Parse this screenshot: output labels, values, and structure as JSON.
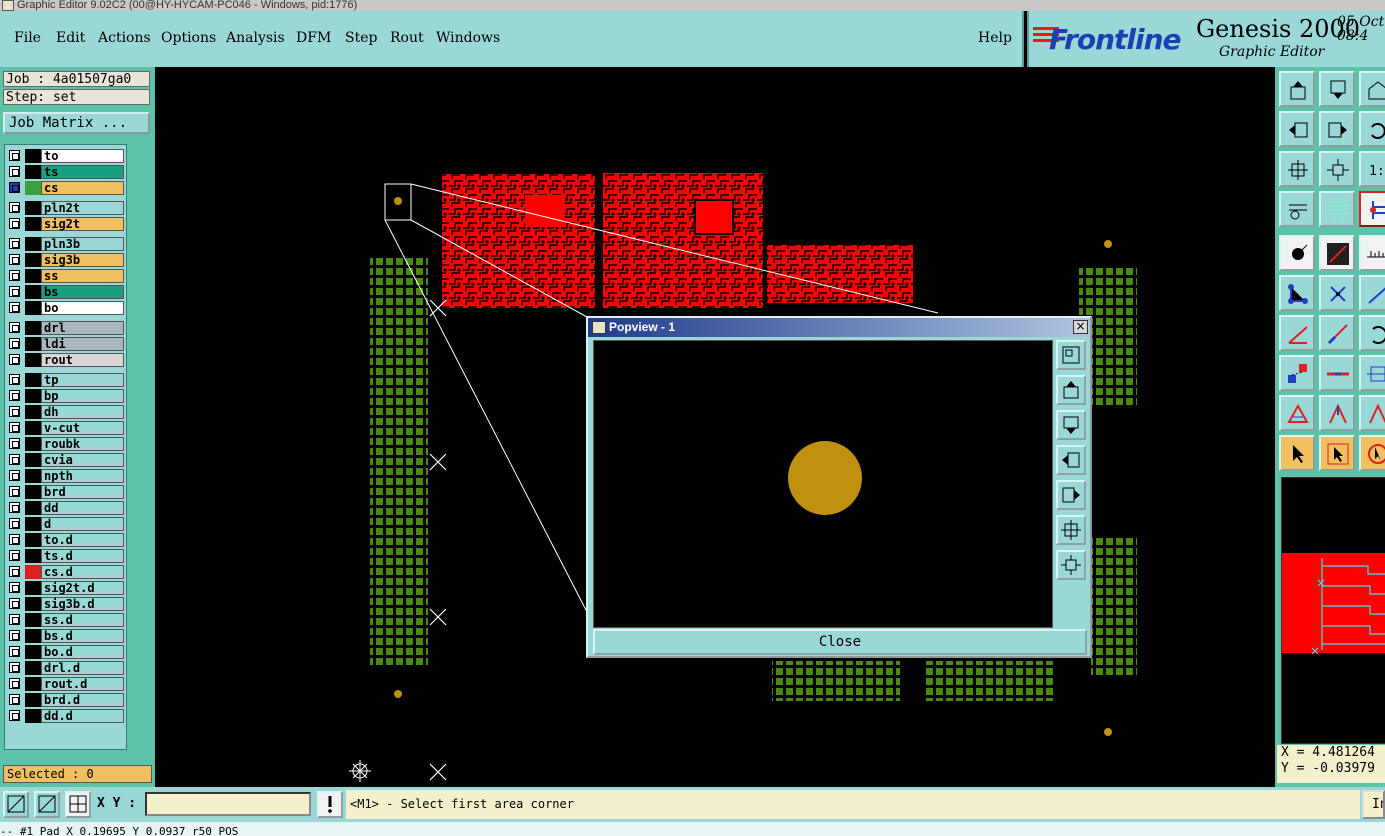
{
  "window_title": "Graphic Editor 9.02C2 (00@HY-HYCAM-PC046 - Windows, pid:1776)",
  "menu": [
    "File",
    "Edit",
    "Actions",
    "Options",
    "Analysis",
    "DFM",
    "Step",
    "Rout",
    "Windows"
  ],
  "help_label": "Help",
  "brand": {
    "logo": "Frontline",
    "product": "Genesis 2000",
    "subtitle": "Graphic Editor",
    "date": "05 Oct",
    "time": "08:4"
  },
  "job": {
    "job_line": "Job : 4a01507ga0",
    "step_line": "Step: set",
    "job_matrix_label": "Job Matrix ..."
  },
  "layers": [
    {
      "name": "to",
      "color": "#ffffff"
    },
    {
      "name": "ts",
      "color": "#1aa080"
    },
    {
      "name": "cs",
      "color": "#f0c060"
    },
    {
      "name": "pln2t",
      "color": "#9ad8d8"
    },
    {
      "name": "sig2t",
      "color": "#f0c060"
    },
    {
      "name": "pln3b",
      "color": "#9ad8d8"
    },
    {
      "name": "sig3b",
      "color": "#f0c060"
    },
    {
      "name": "ss",
      "color": "#f0c060"
    },
    {
      "name": "bs",
      "color": "#1aa080"
    },
    {
      "name": "bo",
      "color": "#ffffff"
    },
    {
      "name": "drl",
      "color": "#a8b8c0"
    },
    {
      "name": "ldi",
      "color": "#a8b8c0"
    },
    {
      "name": "rout",
      "color": "#d8d8d8"
    },
    {
      "name": "tp",
      "color": "#9ad8d8"
    },
    {
      "name": "bp",
      "color": "#9ad8d8"
    },
    {
      "name": "dh",
      "color": "#9ad8d8"
    },
    {
      "name": "v-cut",
      "color": "#9ad8d8"
    },
    {
      "name": "roubk",
      "color": "#9ad8d8"
    },
    {
      "name": "cvia",
      "color": "#9ad8d8"
    },
    {
      "name": "npth",
      "color": "#9ad8d8"
    },
    {
      "name": "brd",
      "color": "#9ad8d8"
    },
    {
      "name": "dd",
      "color": "#9ad8d8"
    },
    {
      "name": "d",
      "color": "#9ad8d8"
    },
    {
      "name": "to.d",
      "color": "#9ad8d8"
    },
    {
      "name": "ts.d",
      "color": "#9ad8d8"
    },
    {
      "name": "cs.d",
      "color": "#9ad8d8"
    },
    {
      "name": "sig2t.d",
      "color": "#9ad8d8"
    },
    {
      "name": "sig3b.d",
      "color": "#9ad8d8"
    },
    {
      "name": "ss.d",
      "color": "#9ad8d8"
    },
    {
      "name": "bs.d",
      "color": "#9ad8d8"
    },
    {
      "name": "bo.d",
      "color": "#9ad8d8"
    },
    {
      "name": "drl.d",
      "color": "#9ad8d8"
    },
    {
      "name": "rout.d",
      "color": "#9ad8d8"
    },
    {
      "name": "brd.d",
      "color": "#9ad8d8"
    },
    {
      "name": "dd.d",
      "color": "#9ad8d8"
    }
  ],
  "selected_label": "Selected : 0",
  "coords": {
    "x": "X = 4.481264",
    "y": "Y = -0.03979"
  },
  "bottom": {
    "xy_label": "X Y :",
    "xy_value": "",
    "message": "<M1> - Select first area corner",
    "info_btn": "In"
  },
  "status_line": "-- #1 Pad X 0.19695 Y 0.0937 r50 POS",
  "popview": {
    "title": "Popview - 1",
    "close_label": "Close"
  },
  "colors": {
    "panel": "#9ad8d8",
    "accent": "#5cc2a8",
    "copper": "#ff0000",
    "pad": "#4a8a10",
    "drill": "#c09010"
  }
}
